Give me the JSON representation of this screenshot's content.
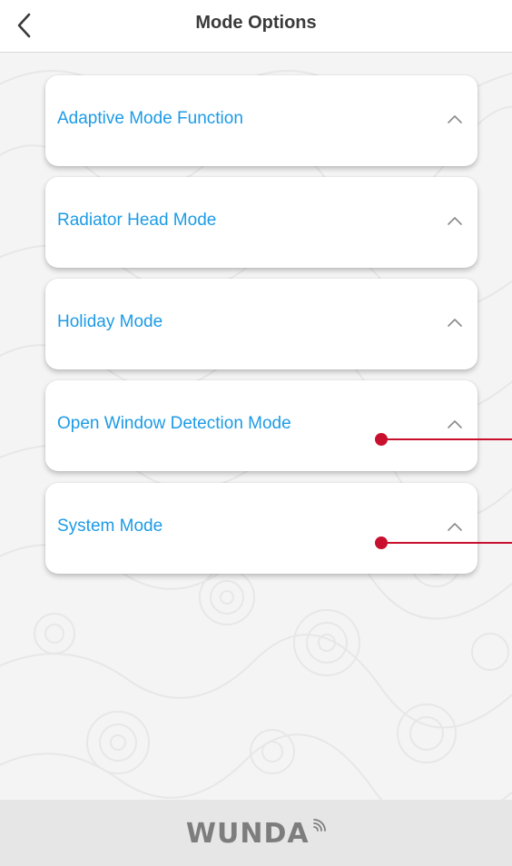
{
  "header": {
    "title": "Mode Options",
    "back_icon": "chevron-left-icon"
  },
  "modes": [
    {
      "label": "Adaptive Mode Function",
      "expanded": true
    },
    {
      "label": "Radiator Head Mode",
      "expanded": true
    },
    {
      "label": "Holiday Mode",
      "expanded": true
    },
    {
      "label": "Open Window Detection Mode",
      "expanded": true
    },
    {
      "label": "System Mode",
      "expanded": true
    }
  ],
  "footer": {
    "brand": "WUNDA"
  },
  "colors": {
    "accent": "#1c9be6",
    "title": "#3a3a3a",
    "marker": "#c8102e",
    "footer_bg": "#e6e6e6",
    "logo": "#7d7d7d"
  }
}
